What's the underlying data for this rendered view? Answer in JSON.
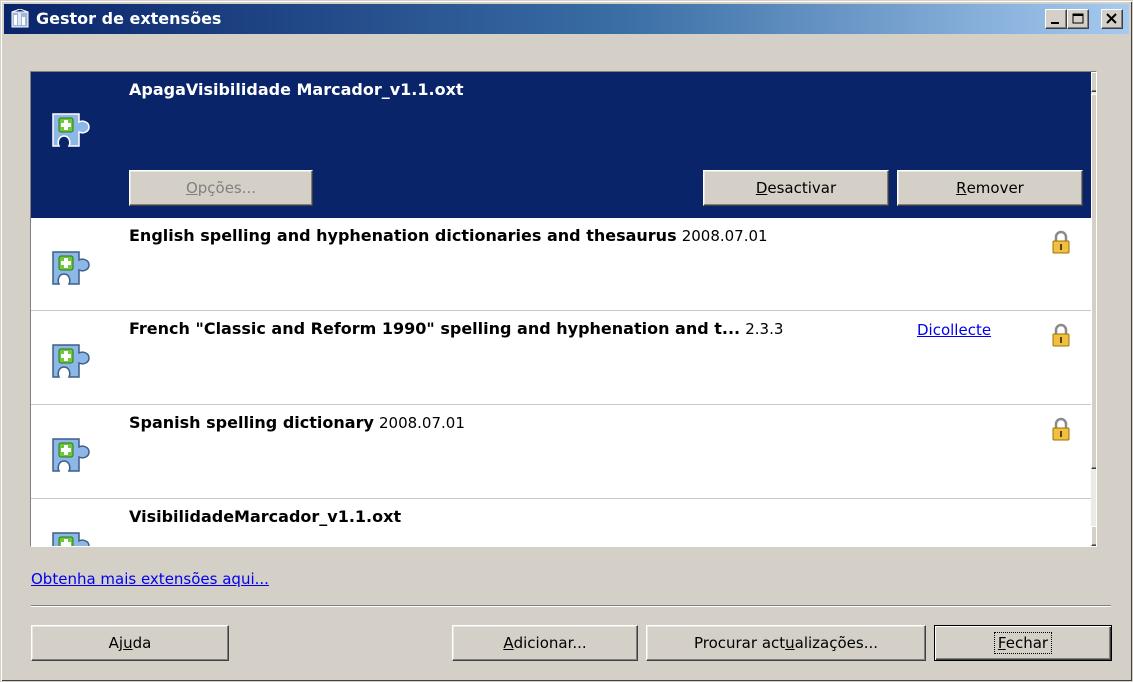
{
  "window": {
    "title": "Gestor de extensões",
    "colors": {
      "title_gradient_start": "#0a246a",
      "title_gradient_end": "#a6caf0",
      "selection": "#0a246a",
      "link": "#0000ee"
    }
  },
  "extensions": [
    {
      "name": "ApagaVisibilidade Marcador_v1.1.oxt",
      "version": "",
      "publisher": "",
      "selected": true,
      "locked": false,
      "icon": "extension-puzzle-icon"
    },
    {
      "name": "English spelling and hyphenation dictionaries and thesaurus",
      "version": "2008.07.01",
      "publisher": "",
      "selected": false,
      "locked": true,
      "icon": "extension-puzzle-icon"
    },
    {
      "name": "French \"Classic and Reform 1990\" spelling and hyphenation and t...",
      "version": "2.3.3",
      "publisher": "Dicollecte",
      "selected": false,
      "locked": true,
      "icon": "extension-puzzle-icon"
    },
    {
      "name": "Spanish spelling dictionary",
      "version": "2008.07.01",
      "publisher": "",
      "selected": false,
      "locked": true,
      "icon": "extension-puzzle-icon"
    },
    {
      "name": "VisibilidadeMarcador_v1.1.oxt",
      "version": "",
      "publisher": "",
      "selected": false,
      "locked": false,
      "icon": "extension-puzzle-icon"
    }
  ],
  "item_buttons": {
    "options": {
      "pre": "",
      "mnemonic": "O",
      "post": "pções..."
    },
    "disable": {
      "pre": "",
      "mnemonic": "D",
      "post": "esactivar"
    },
    "remove": {
      "pre": "",
      "mnemonic": "R",
      "post": "emover"
    }
  },
  "more_link": "Obtenha mais extensões aqui...",
  "footer": {
    "help": {
      "pre": "Aj",
      "mnemonic": "u",
      "post": "da"
    },
    "add": {
      "pre": "",
      "mnemonic": "A",
      "post": "dicionar..."
    },
    "check_updates": {
      "pre": "Procurar act",
      "mnemonic": "u",
      "post": "alizações..."
    },
    "close": {
      "pre": "",
      "mnemonic": "F",
      "post": "echar"
    }
  }
}
